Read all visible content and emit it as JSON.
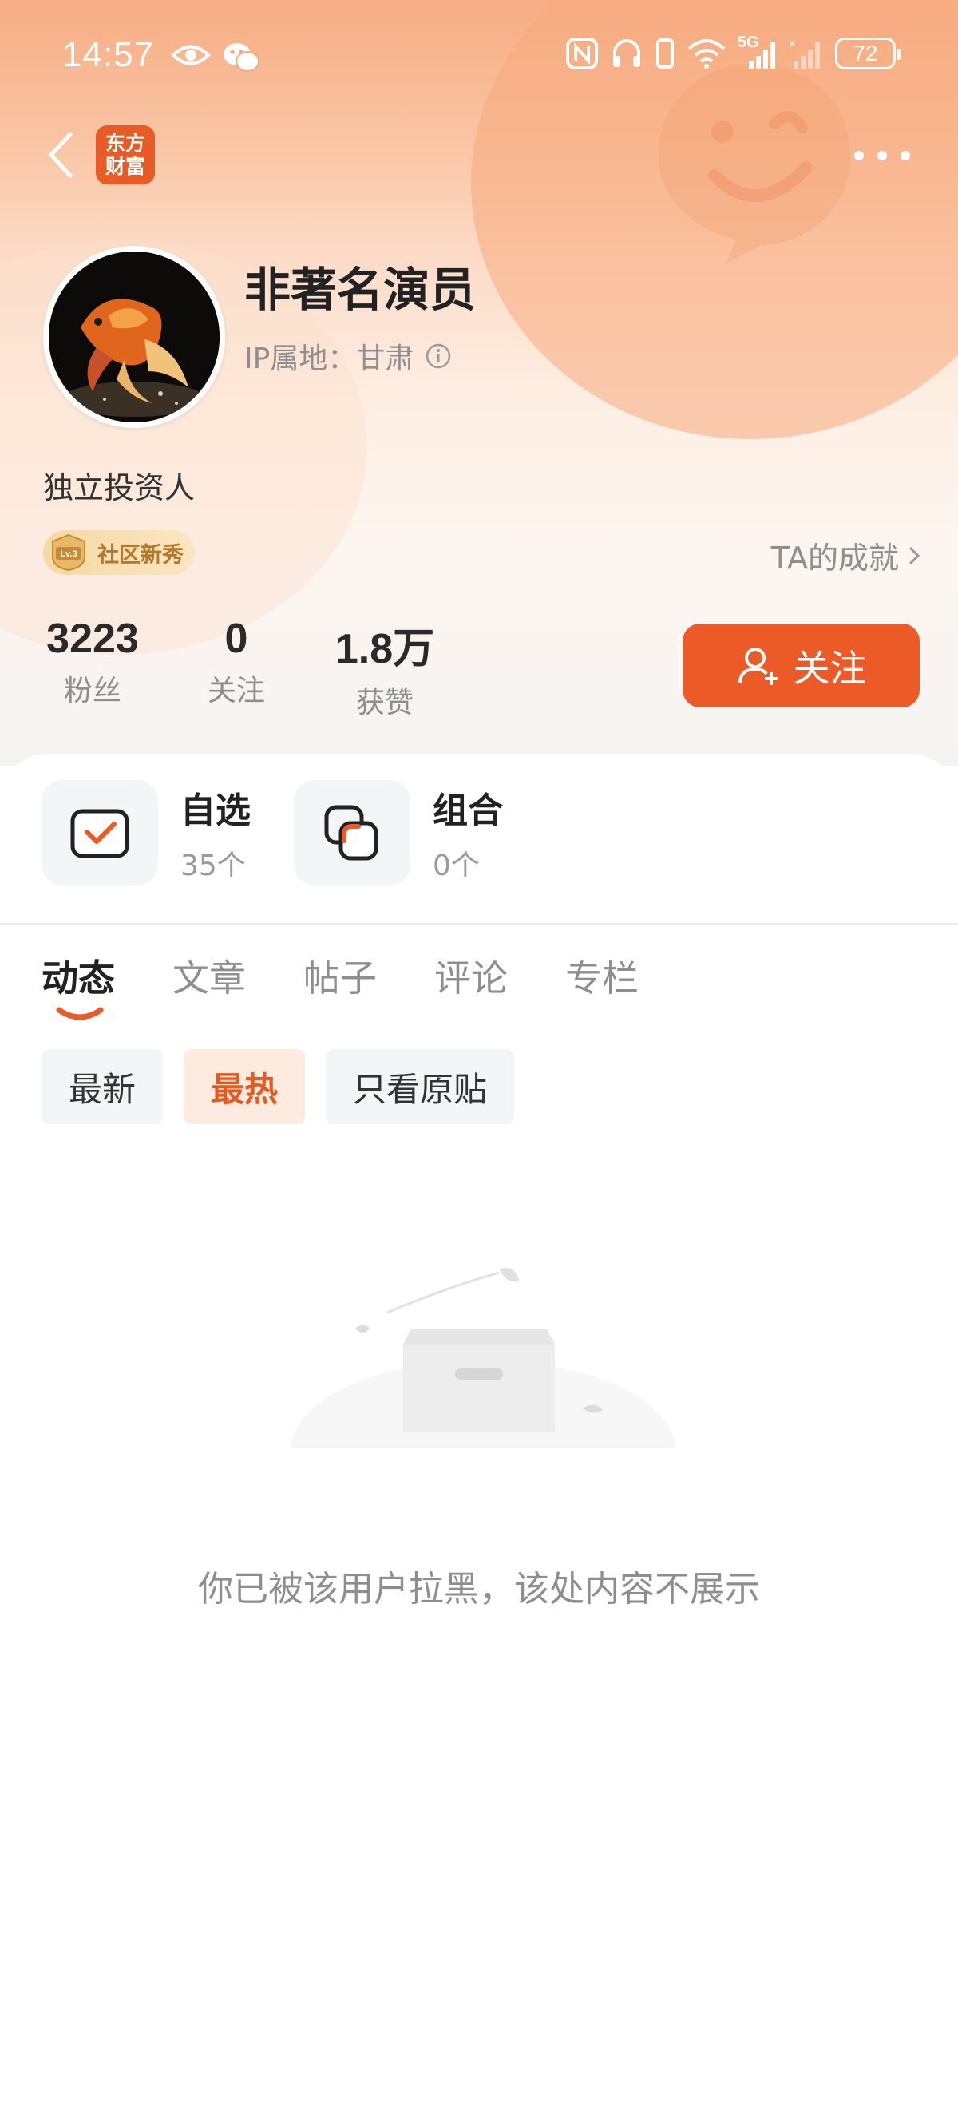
{
  "status_bar": {
    "time": "14:57",
    "left_icons": [
      "eye-icon",
      "wechat-icon"
    ],
    "right_icons": [
      "nfc-icon",
      "headphones-icon",
      "vibrate-icon",
      "wifi-icon",
      "signal-5g-icon",
      "signal-no-sim-icon"
    ],
    "network_label": "5G",
    "battery": "72"
  },
  "nav": {
    "back_icon": "chevron-left-icon",
    "app_logo_line1": "东方",
    "app_logo_line2": "财富",
    "more_icon": "more-dots-icon"
  },
  "profile": {
    "username": "非著名演员",
    "ip_location": "IP属地：甘肃",
    "bio": "独立投资人",
    "badge_level": "Lv.3",
    "badge_label": "社区新秀",
    "achievements_link": "TA的成就"
  },
  "stats": [
    {
      "value": "3223",
      "label": "粉丝"
    },
    {
      "value": "0",
      "label": "关注"
    },
    {
      "value": "1.8万",
      "label": "获赞"
    }
  ],
  "follow_button": "关注",
  "shortcuts": [
    {
      "title": "自选",
      "count": "35个",
      "icon": "watchlist-check-icon"
    },
    {
      "title": "组合",
      "count": "0个",
      "icon": "portfolio-squares-icon"
    }
  ],
  "tabs": [
    {
      "label": "动态",
      "active": true
    },
    {
      "label": "文章",
      "active": false
    },
    {
      "label": "帖子",
      "active": false
    },
    {
      "label": "评论",
      "active": false
    },
    {
      "label": "专栏",
      "active": false
    }
  ],
  "filters": [
    {
      "label": "最新",
      "active": false
    },
    {
      "label": "最热",
      "active": true
    },
    {
      "label": "只看原贴",
      "active": false
    }
  ],
  "empty_state": {
    "illustration": "empty-box-illustration",
    "message": "你已被该用户拉黑，该处内容不展示"
  },
  "colors": {
    "accent": "#ec5b27",
    "header_gradient_top": "#f6ad84",
    "chip_active_bg": "#fdebe0",
    "chip_active_text": "#e35a24",
    "badge_text": "#b4772e"
  }
}
